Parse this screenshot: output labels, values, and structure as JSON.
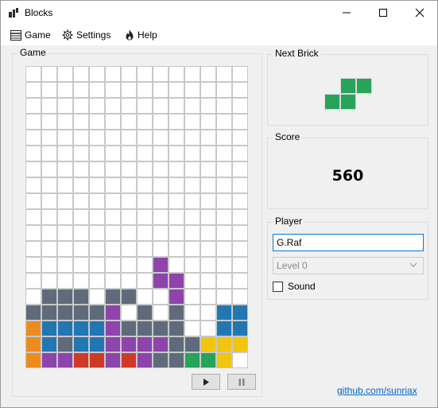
{
  "window": {
    "title": "Blocks"
  },
  "menu": {
    "game": "Game",
    "settings": "Settings",
    "help": "Help"
  },
  "game_group": {
    "label": "Game"
  },
  "next_group": {
    "label": "Next Brick"
  },
  "score_group": {
    "label": "Score",
    "value": "560"
  },
  "player_group": {
    "label": "Player",
    "name_value": "G.Raf",
    "level_value": "Level 0",
    "sound_label": "Sound",
    "sound_checked": false
  },
  "link": "github.com/sunriax",
  "colors": {
    "O": "#ed8b1f",
    "G": "#5f6b7a",
    "B": "#2277b3",
    "P": "#8e44ad",
    "R": "#cf3a26",
    "Y": "#f1c40f",
    "N": "#27a35a"
  },
  "board": {
    "rows": [
      "..............",
      "..............",
      "..............",
      "..............",
      "..............",
      "..............",
      "..............",
      "..............",
      "..............",
      "..............",
      "..............",
      "..............",
      "..............",
      "..............",
      ".GGG.GG.......",
      "GGGGGP.G.G..BB",
      "OBBBBPGGGG..BB",
      "OBGBBPPPPGGYYY",
      "OPPRRPRPGGNNY."
    ]
  },
  "falling_piece": {
    "color": "P",
    "cells": [
      [
        12,
        8
      ],
      [
        13,
        8
      ],
      [
        13,
        9
      ],
      [
        14,
        9
      ]
    ]
  },
  "next_brick": {
    "color": "N",
    "cells": [
      [
        0,
        1
      ],
      [
        0,
        2
      ],
      [
        1,
        0
      ],
      [
        1,
        1
      ]
    ]
  },
  "icons": {
    "app": "blocks-app-icon",
    "minimize": "minimize-icon",
    "maximize": "maximize-icon",
    "close": "close-icon",
    "game_menu": "list-icon",
    "settings_menu": "gear-icon",
    "help_menu": "flame-icon",
    "play": "play-icon",
    "pause": "pause-icon"
  }
}
